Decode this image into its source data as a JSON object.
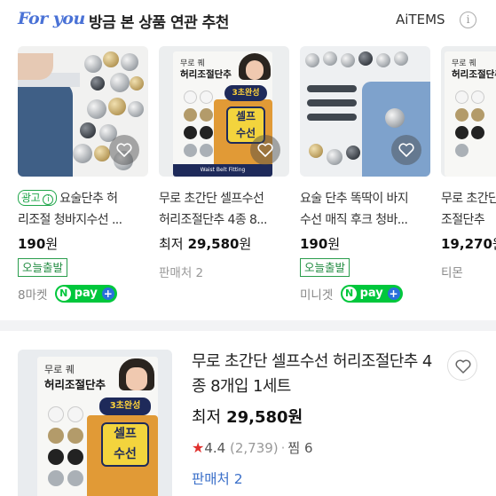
{
  "header": {
    "brand": "For you",
    "title": "방금 본 상품 연관 추천",
    "provider": "AiTEMS",
    "info_glyph": "i"
  },
  "cards": [
    {
      "ad_label": "광고",
      "title_line1": "요술단추 허",
      "title_line2": "리조절 청바지수선 ...",
      "price_prefix": "",
      "price": "190",
      "currency": "원",
      "ship": "오늘출발",
      "store": "8마켓",
      "npay": "pay"
    },
    {
      "title_line1": "무로 초간단 셀프수선",
      "title_line2": "허리조절단추 4종 8...",
      "price_prefix": "최저",
      "price": "29,580",
      "currency": "원",
      "store": "판매처 2"
    },
    {
      "title_line1": "요술 단추 똑딱이 바지",
      "title_line2": "수선 매직 후크 청바...",
      "price_prefix": "",
      "price": "190",
      "currency": "원",
      "ship": "오늘출발",
      "store": "미니겟",
      "npay": "pay"
    },
    {
      "title_line1": "무로 초간단 셀",
      "title_line2": "조절단추",
      "price_prefix": "",
      "price": "19,270",
      "currency": "원",
      "store": "티몬"
    }
  ],
  "package_art": {
    "brand": "무로 퀘",
    "name": "허리조절단추",
    "badge": "3초완성",
    "self_line1": "셀프",
    "self_line2": "수선",
    "base": "Waist Belt Fitting"
  },
  "detail": {
    "title": "무로 초간단 셀프수선 허리조절단추 4종 8개입 1세트",
    "price_prefix": "최저",
    "price": "29,580원",
    "rating": "4.4",
    "reviews": "(2,739)",
    "dot": "·",
    "wish": "찜 6",
    "sellers": "판매처 2"
  },
  "colors": {
    "brand_blue": "#4a72d6",
    "npay_green": "#00c73c",
    "ship_green": "#1f8a3f",
    "seller_link": "#3a6fc9",
    "star_red": "#e0302d"
  }
}
